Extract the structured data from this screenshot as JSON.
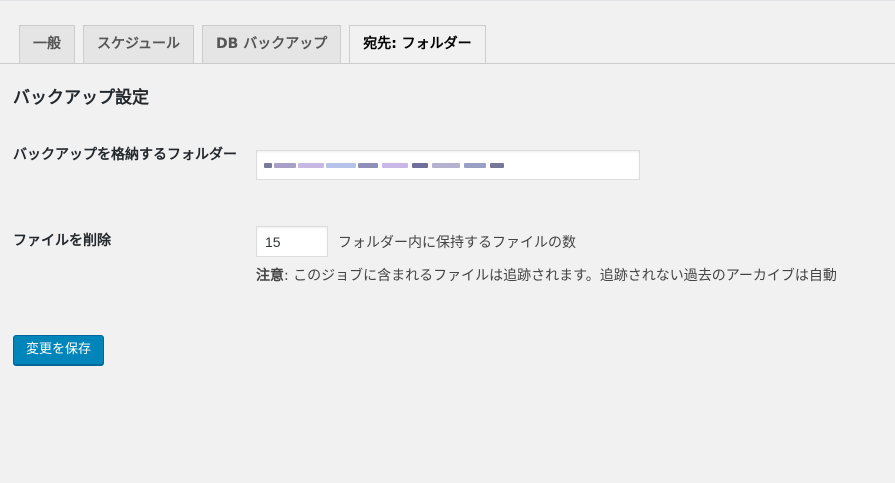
{
  "tabs": [
    {
      "label": "一般",
      "active": false
    },
    {
      "label": "スケジュール",
      "active": false
    },
    {
      "label": "DB バックアップ",
      "active": false
    },
    {
      "label": "宛先: フォルダー",
      "active": true
    }
  ],
  "section_title": "バックアップ設定",
  "folder_row": {
    "label": "バックアップを格納するフォルダー",
    "value": "",
    "value_obscured": true
  },
  "delete_row": {
    "label": "ファイルを削除",
    "count_value": "15",
    "suffix": "フォルダー内に保持するファイルの数",
    "note_label": "注意",
    "note_text": ": このジョブに含まれるファイルは追跡されます。追跡されない過去のアーカイブは自動"
  },
  "save_button": "変更を保存",
  "colors": {
    "background": "#f1f1f1",
    "primary_button": "#0085ba",
    "tab_inactive": "#e5e5e5"
  }
}
